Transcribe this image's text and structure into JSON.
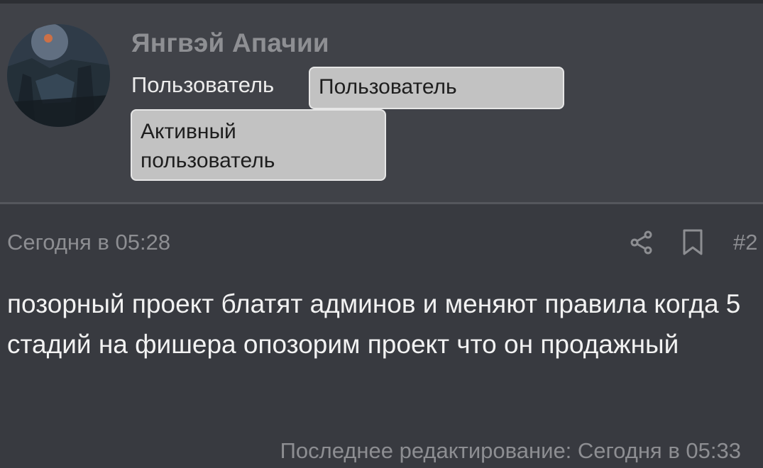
{
  "user": {
    "name": "Янгвэй Апачии",
    "role_label": "Пользователь",
    "badges": [
      {
        "label": "Пользователь"
      },
      {
        "label": "Активный\nпользователь"
      }
    ]
  },
  "post": {
    "time": "Сегодня в 05:28",
    "number": "#2",
    "body": "позорный проект блатят админов и меняют правила когда 5 стадий на фишера опозорим проект что он продажный",
    "edit_note": "Последнее редактирование: Сегодня в 05:33",
    "icons": {
      "share": "share-icon",
      "bookmark": "bookmark-icon"
    }
  },
  "colors": {
    "background": "#383a40",
    "user_block": "#404248",
    "badge_bg": "#c2c2c2",
    "muted_text": "#8d8e92",
    "body_text": "#f2f2f2"
  }
}
